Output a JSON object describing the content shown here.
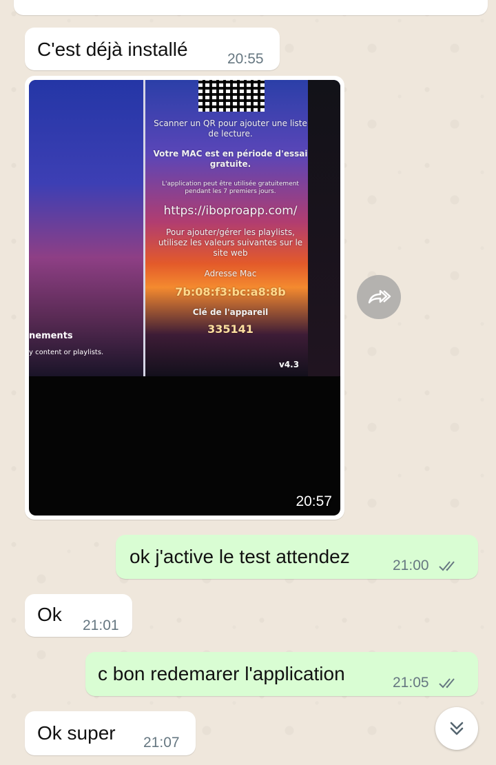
{
  "messages": [
    {
      "id": "m1",
      "direction": "in",
      "text": "C'est déjà installé",
      "time": "20:55"
    },
    {
      "id": "m2",
      "direction": "in",
      "type": "image",
      "time": "20:57",
      "image_screen": {
        "scan_qr": "Scanner un QR pour ajouter une liste de lecture.",
        "trial": "Votre MAC est en période d'essai gratuite.",
        "free_use": "L'application peut être utilisée gratuitement pendant les 7 premiers jours.",
        "url": "https://iboproapp.com/",
        "manage": "Pour ajouter/gérer les playlists, utilisez les valeurs suivantes sur le site web",
        "mac_label": "Adresse Mac",
        "mac_value": "7b:08:f3:bc:a8:8b",
        "key_label": "Clé de l'appareil",
        "key_value": "335141",
        "version": "v4.3",
        "left_heading": "nements",
        "left_sub": "y content or playlists."
      }
    },
    {
      "id": "m3",
      "direction": "out",
      "text": "ok j'active le test attendez",
      "time": "21:00",
      "status": "read"
    },
    {
      "id": "m4",
      "direction": "in",
      "text": "Ok",
      "time": "21:01"
    },
    {
      "id": "m5",
      "direction": "out",
      "text": "c bon redemarer l'application",
      "time": "21:05",
      "status": "read"
    },
    {
      "id": "m6",
      "direction": "in",
      "text": "Ok super",
      "time": "21:07"
    }
  ],
  "icons": {
    "forward": "forward-icon",
    "scroll_down": "double-chevron-down-icon",
    "read_ticks": "double-check-icon"
  },
  "colors": {
    "incoming": "#ffffff",
    "outgoing": "#d9fdd3",
    "background": "#efe7dc",
    "time": "#667781",
    "ticks": "#667781"
  }
}
